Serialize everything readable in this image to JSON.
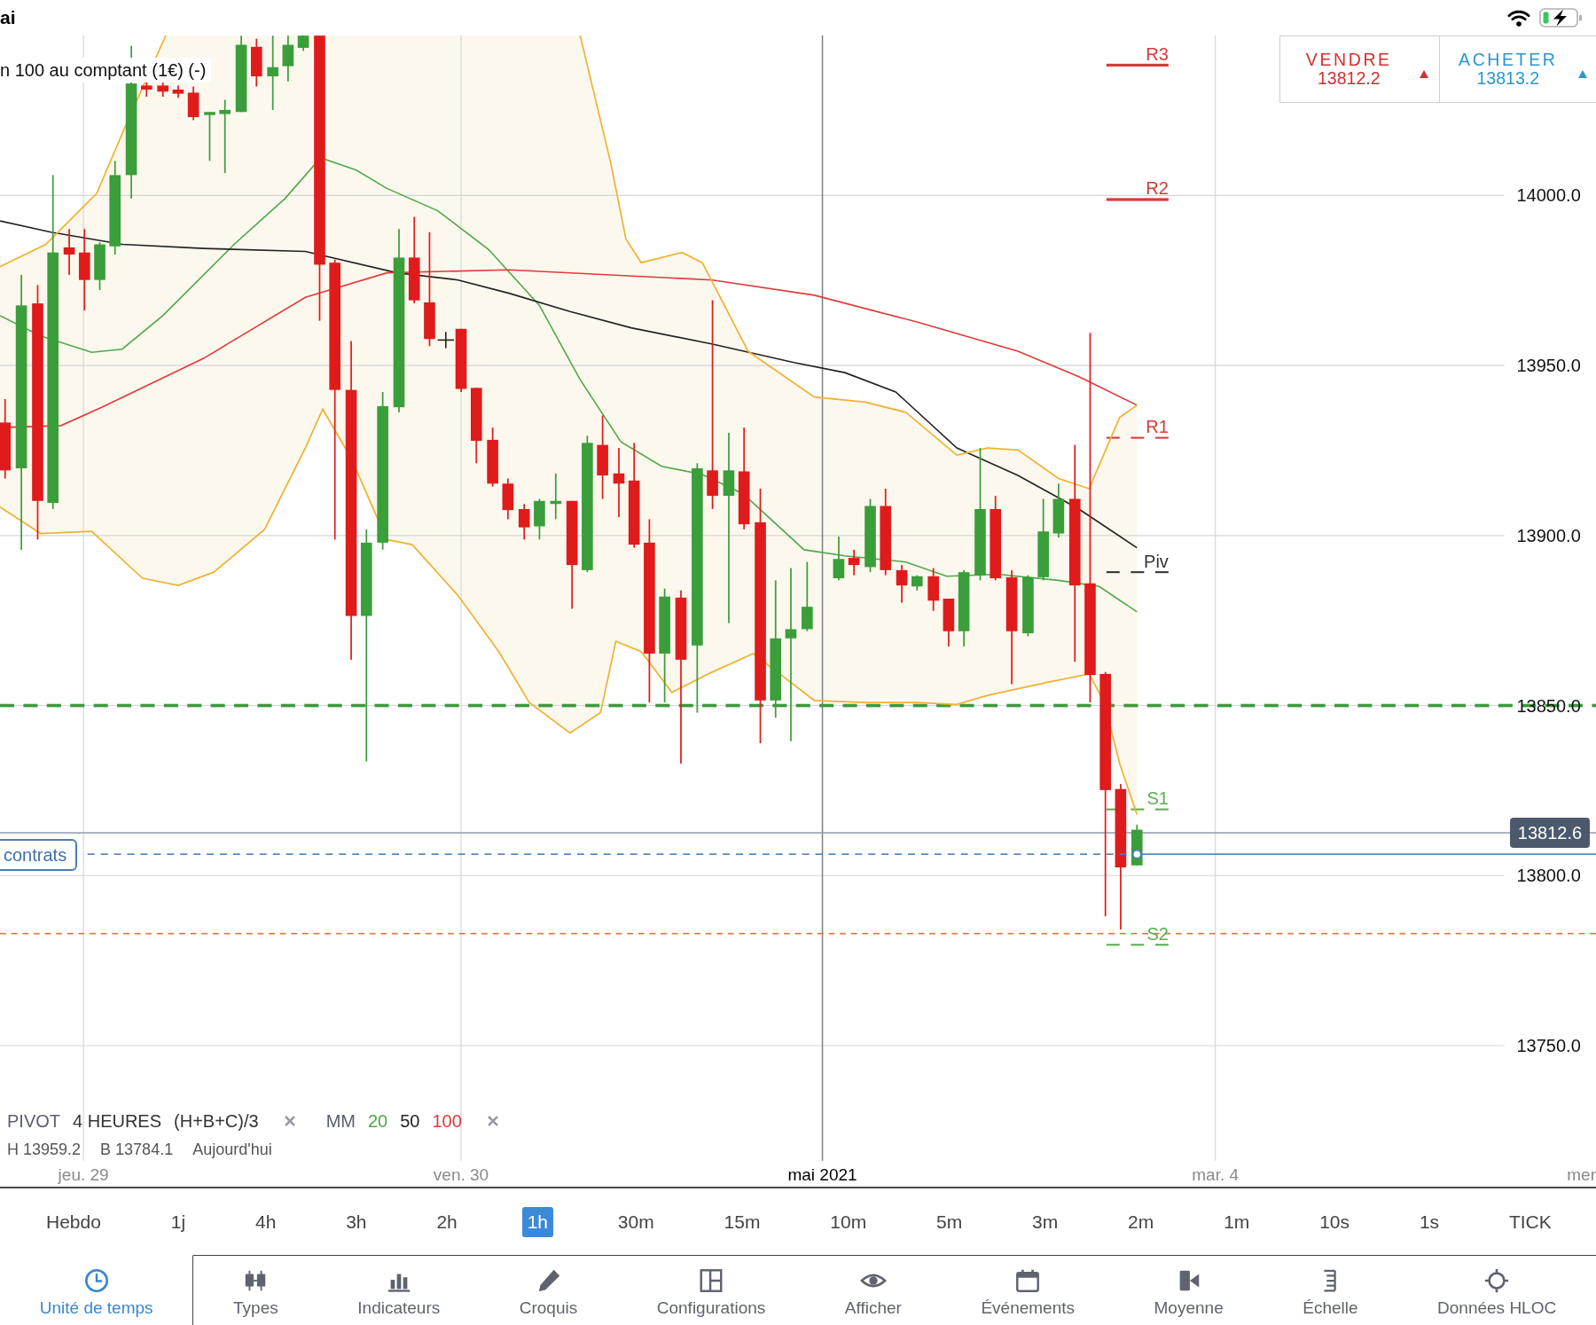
{
  "status_bar": {
    "time": "ai"
  },
  "chart": {
    "title": "n 100 au comptant (1€) (-)",
    "quote": [
      {
        "kind": "sell",
        "label": "VENDRE",
        "price": "13812.2",
        "rising": true
      },
      {
        "kind": "buy",
        "label": "ACHETER",
        "price": "13813.2",
        "rising": true
      }
    ],
    "pivot_levels": [
      {
        "label": "R3",
        "color": "#d83a3a",
        "dashed": false
      },
      {
        "label": "R2",
        "color": "#d83a3a",
        "dashed": false
      },
      {
        "label": "R1",
        "color": "#d83a3a",
        "dashed": true
      },
      {
        "label": "Piv",
        "color": "#333333",
        "dashed": true
      },
      {
        "label": "S1",
        "color": "#5aae4e",
        "dashed": true
      },
      {
        "label": "S2",
        "color": "#5aae4e",
        "dashed": true
      }
    ],
    "price_axis": [
      "14000.0",
      "13950.0",
      "13900.0",
      "13850.0",
      "13800.0",
      "13750.0"
    ],
    "current_price": "13812.6",
    "position": {
      "label": "contrats"
    },
    "legend": {
      "pivot": [
        "PIVOT",
        "4 HEURES",
        "(H+B+C)/3"
      ],
      "moving_averages": {
        "label": "MM",
        "periods": [
          {
            "label": "20",
            "color": "#4ea84a"
          },
          {
            "label": "50",
            "color": "#222222"
          },
          {
            "label": "100",
            "color": "#e03a3a"
          }
        ]
      },
      "values": [
        "H 13959.2",
        "B 13784.1",
        "Aujourd'hui"
      ]
    },
    "time_axis": [
      {
        "label": "jeu. 29",
        "kind": "day"
      },
      {
        "label": "ven. 30",
        "kind": "day"
      },
      {
        "label": "mai 2021",
        "kind": "month"
      },
      {
        "label": "mar. 4",
        "kind": "day"
      },
      {
        "label": "mer",
        "kind": "day"
      }
    ]
  },
  "timeframes": [
    {
      "label": "Hebdo",
      "selected": false
    },
    {
      "label": "1j",
      "selected": false
    },
    {
      "label": "4h",
      "selected": false
    },
    {
      "label": "3h",
      "selected": false
    },
    {
      "label": "2h",
      "selected": false
    },
    {
      "label": "1h",
      "selected": true
    },
    {
      "label": "30m",
      "selected": false
    },
    {
      "label": "15m",
      "selected": false
    },
    {
      "label": "10m",
      "selected": false
    },
    {
      "label": "5m",
      "selected": false
    },
    {
      "label": "3m",
      "selected": false
    },
    {
      "label": "2m",
      "selected": false
    },
    {
      "label": "1m",
      "selected": false
    },
    {
      "label": "10s",
      "selected": false
    },
    {
      "label": "1s",
      "selected": false
    },
    {
      "label": "TICK",
      "selected": false
    }
  ],
  "toolbar": [
    {
      "label": "Unité de temps",
      "selected": true
    },
    {
      "label": "Types",
      "selected": false
    },
    {
      "label": "Indicateurs",
      "selected": false
    },
    {
      "label": "Croquis",
      "selected": false
    },
    {
      "label": "Configurations",
      "selected": false
    },
    {
      "label": "Afficher",
      "selected": false
    },
    {
      "label": "Événements",
      "selected": false
    },
    {
      "label": "Moyenne",
      "selected": false
    },
    {
      "label": "Échelle",
      "selected": false
    },
    {
      "label": "Données HLOC",
      "selected": false
    }
  ]
}
